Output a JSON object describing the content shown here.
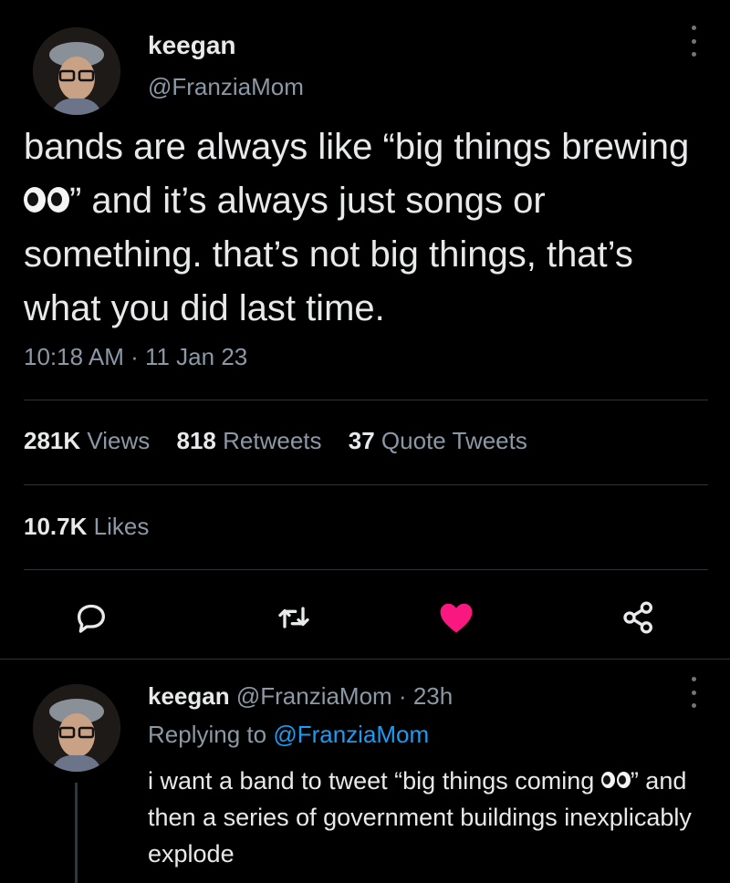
{
  "tweet": {
    "author_name": "keegan",
    "author_handle": "@FranziaMom",
    "text_part1": "bands are always like “big things brewing",
    "text_part2": "” and it’s always just songs or something. that’s not big things, that’s what you did last time.",
    "timestamp": "10:18 AM · 11 Jan 23",
    "stats": {
      "views_count": "281K",
      "views_label": "Views",
      "retweets_count": "818",
      "retweets_label": "Retweets",
      "quotes_count": "37",
      "quotes_label": "Quote Tweets",
      "likes_count": "10.7K",
      "likes_label": "Likes"
    },
    "actions": {
      "reply_icon": "reply-icon",
      "retweet_icon": "retweet-icon",
      "like_icon": "heart-icon",
      "like_color": "#f91880",
      "share_icon": "share-icon"
    }
  },
  "reply": {
    "author_name": "keegan",
    "meta": "@FranziaMom · 23h",
    "replying_prefix": "Replying to",
    "replying_to": "@FranziaMom",
    "text_part1": "i want a band to tweet “big things coming",
    "text_part2": "” and then a series of government buildings inexplicably explode"
  },
  "colors": {
    "background": "#000000",
    "text_primary": "#e7e9ea",
    "text_secondary": "#8b98a5",
    "link": "#1d9bf0",
    "divider": "#2f3336"
  }
}
